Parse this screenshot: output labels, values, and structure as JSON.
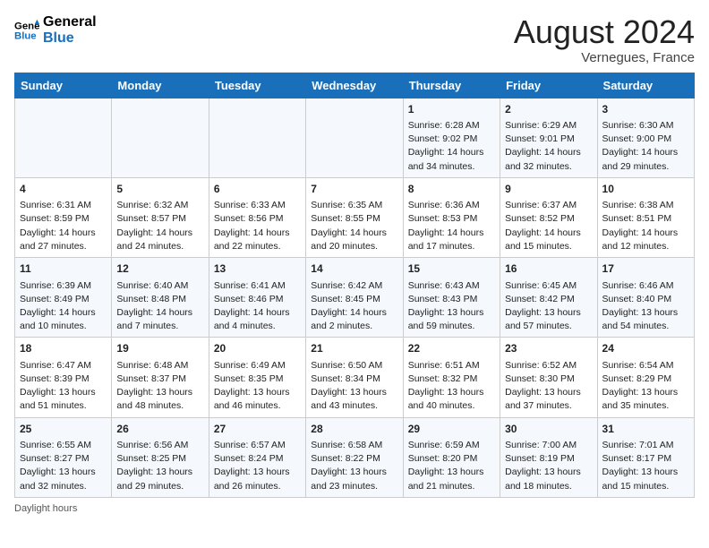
{
  "logo": {
    "line1": "General",
    "line2": "Blue"
  },
  "title": "August 2024",
  "location": "Vernegues, France",
  "days_of_week": [
    "Sunday",
    "Monday",
    "Tuesday",
    "Wednesday",
    "Thursday",
    "Friday",
    "Saturday"
  ],
  "weeks": [
    [
      {
        "day": "",
        "info": ""
      },
      {
        "day": "",
        "info": ""
      },
      {
        "day": "",
        "info": ""
      },
      {
        "day": "",
        "info": ""
      },
      {
        "day": "1",
        "info": "Sunrise: 6:28 AM\nSunset: 9:02 PM\nDaylight: 14 hours and 34 minutes."
      },
      {
        "day": "2",
        "info": "Sunrise: 6:29 AM\nSunset: 9:01 PM\nDaylight: 14 hours and 32 minutes."
      },
      {
        "day": "3",
        "info": "Sunrise: 6:30 AM\nSunset: 9:00 PM\nDaylight: 14 hours and 29 minutes."
      }
    ],
    [
      {
        "day": "4",
        "info": "Sunrise: 6:31 AM\nSunset: 8:59 PM\nDaylight: 14 hours and 27 minutes."
      },
      {
        "day": "5",
        "info": "Sunrise: 6:32 AM\nSunset: 8:57 PM\nDaylight: 14 hours and 24 minutes."
      },
      {
        "day": "6",
        "info": "Sunrise: 6:33 AM\nSunset: 8:56 PM\nDaylight: 14 hours and 22 minutes."
      },
      {
        "day": "7",
        "info": "Sunrise: 6:35 AM\nSunset: 8:55 PM\nDaylight: 14 hours and 20 minutes."
      },
      {
        "day": "8",
        "info": "Sunrise: 6:36 AM\nSunset: 8:53 PM\nDaylight: 14 hours and 17 minutes."
      },
      {
        "day": "9",
        "info": "Sunrise: 6:37 AM\nSunset: 8:52 PM\nDaylight: 14 hours and 15 minutes."
      },
      {
        "day": "10",
        "info": "Sunrise: 6:38 AM\nSunset: 8:51 PM\nDaylight: 14 hours and 12 minutes."
      }
    ],
    [
      {
        "day": "11",
        "info": "Sunrise: 6:39 AM\nSunset: 8:49 PM\nDaylight: 14 hours and 10 minutes."
      },
      {
        "day": "12",
        "info": "Sunrise: 6:40 AM\nSunset: 8:48 PM\nDaylight: 14 hours and 7 minutes."
      },
      {
        "day": "13",
        "info": "Sunrise: 6:41 AM\nSunset: 8:46 PM\nDaylight: 14 hours and 4 minutes."
      },
      {
        "day": "14",
        "info": "Sunrise: 6:42 AM\nSunset: 8:45 PM\nDaylight: 14 hours and 2 minutes."
      },
      {
        "day": "15",
        "info": "Sunrise: 6:43 AM\nSunset: 8:43 PM\nDaylight: 13 hours and 59 minutes."
      },
      {
        "day": "16",
        "info": "Sunrise: 6:45 AM\nSunset: 8:42 PM\nDaylight: 13 hours and 57 minutes."
      },
      {
        "day": "17",
        "info": "Sunrise: 6:46 AM\nSunset: 8:40 PM\nDaylight: 13 hours and 54 minutes."
      }
    ],
    [
      {
        "day": "18",
        "info": "Sunrise: 6:47 AM\nSunset: 8:39 PM\nDaylight: 13 hours and 51 minutes."
      },
      {
        "day": "19",
        "info": "Sunrise: 6:48 AM\nSunset: 8:37 PM\nDaylight: 13 hours and 48 minutes."
      },
      {
        "day": "20",
        "info": "Sunrise: 6:49 AM\nSunset: 8:35 PM\nDaylight: 13 hours and 46 minutes."
      },
      {
        "day": "21",
        "info": "Sunrise: 6:50 AM\nSunset: 8:34 PM\nDaylight: 13 hours and 43 minutes."
      },
      {
        "day": "22",
        "info": "Sunrise: 6:51 AM\nSunset: 8:32 PM\nDaylight: 13 hours and 40 minutes."
      },
      {
        "day": "23",
        "info": "Sunrise: 6:52 AM\nSunset: 8:30 PM\nDaylight: 13 hours and 37 minutes."
      },
      {
        "day": "24",
        "info": "Sunrise: 6:54 AM\nSunset: 8:29 PM\nDaylight: 13 hours and 35 minutes."
      }
    ],
    [
      {
        "day": "25",
        "info": "Sunrise: 6:55 AM\nSunset: 8:27 PM\nDaylight: 13 hours and 32 minutes."
      },
      {
        "day": "26",
        "info": "Sunrise: 6:56 AM\nSunset: 8:25 PM\nDaylight: 13 hours and 29 minutes."
      },
      {
        "day": "27",
        "info": "Sunrise: 6:57 AM\nSunset: 8:24 PM\nDaylight: 13 hours and 26 minutes."
      },
      {
        "day": "28",
        "info": "Sunrise: 6:58 AM\nSunset: 8:22 PM\nDaylight: 13 hours and 23 minutes."
      },
      {
        "day": "29",
        "info": "Sunrise: 6:59 AM\nSunset: 8:20 PM\nDaylight: 13 hours and 21 minutes."
      },
      {
        "day": "30",
        "info": "Sunrise: 7:00 AM\nSunset: 8:19 PM\nDaylight: 13 hours and 18 minutes."
      },
      {
        "day": "31",
        "info": "Sunrise: 7:01 AM\nSunset: 8:17 PM\nDaylight: 13 hours and 15 minutes."
      }
    ]
  ],
  "footer": "Daylight hours"
}
